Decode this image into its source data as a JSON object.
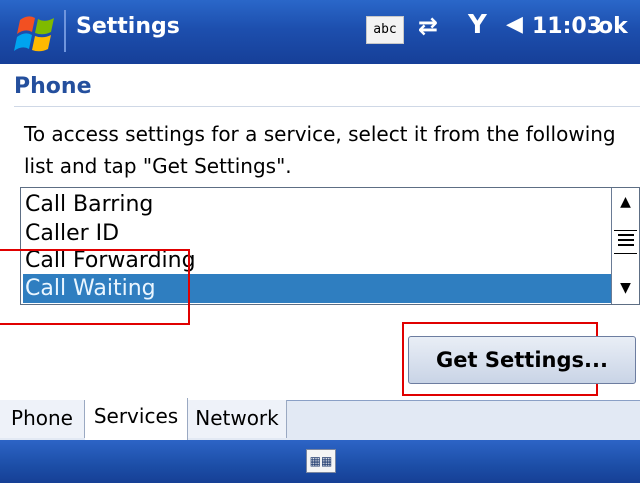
{
  "titlebar": {
    "title": "Settings",
    "input_indicator": "abc",
    "time": "11:03",
    "ok_label": "ok"
  },
  "page": {
    "heading": "Phone",
    "description": "To access settings for a service, select it from the following list and tap \"Get Settings\"."
  },
  "services": {
    "items": [
      "Call Barring",
      "Caller ID",
      "Call Forwarding",
      "Call Waiting"
    ],
    "selected": "Call Waiting"
  },
  "actions": {
    "get_settings_label": "Get Settings..."
  },
  "tabs": [
    {
      "label": "Phone"
    },
    {
      "label": "Services"
    },
    {
      "label": "Network"
    }
  ],
  "icons": {
    "start": "windows-flag-icon",
    "connectivity": "connectivity-icon",
    "signal": "signal-antenna-icon",
    "volume": "speaker-icon",
    "keyboard": "keyboard-icon"
  },
  "colors": {
    "titlebar": "#1d4fae",
    "heading": "#244f9d",
    "selection": "#2f7ec0",
    "annotation": "#e00000"
  }
}
